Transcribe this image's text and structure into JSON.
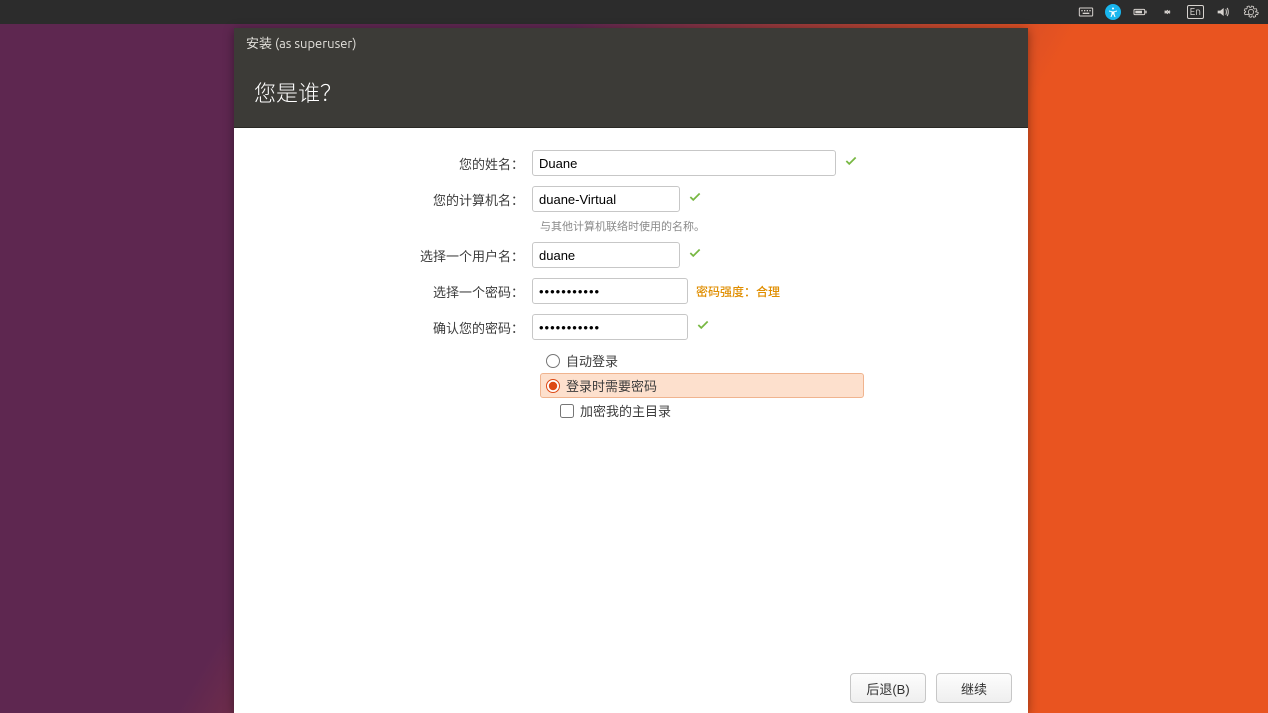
{
  "menubar": {
    "language": "En"
  },
  "dialog": {
    "title": "安装 (as superuser)",
    "heading": "您是谁？"
  },
  "form": {
    "name_label": "您的姓名：",
    "name_value": "Duane",
    "host_label": "您的计算机名：",
    "host_value": "duane-Virtual",
    "host_hint": "与其他计算机联络时使用的名称。",
    "user_label": "选择一个用户名：",
    "user_value": "duane",
    "pwd_label": "选择一个密码：",
    "pwd_value": "•••••••••••",
    "pwd_strength": "密码强度：合理",
    "confirm_label": "确认您的密码：",
    "confirm_value": "•••••••••••",
    "radio_auto": "自动登录",
    "radio_require": "登录时需要密码",
    "check_encrypt": "加密我的主目录"
  },
  "footer": {
    "back": "后退(B)",
    "continue": "继续"
  }
}
